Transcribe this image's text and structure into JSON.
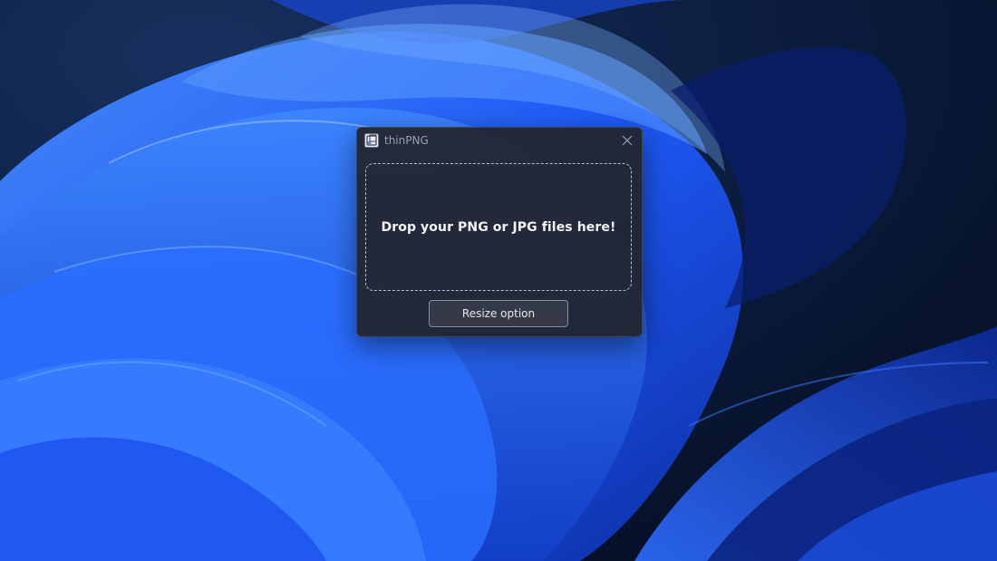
{
  "window": {
    "title": "thinPNG",
    "app_icon": "thinpng-app-icon",
    "close_icon": "close-icon"
  },
  "dropzone": {
    "text": "Drop your PNG or JPG files here!"
  },
  "buttons": {
    "resize_label": "Resize option"
  },
  "colors": {
    "window_bg": "#22242c",
    "dropzone_border": "#b8bcc6",
    "text_primary": "#f2f3f5",
    "title_text": "#9aa1ad",
    "wallpaper_accent": "#1f5cff"
  }
}
